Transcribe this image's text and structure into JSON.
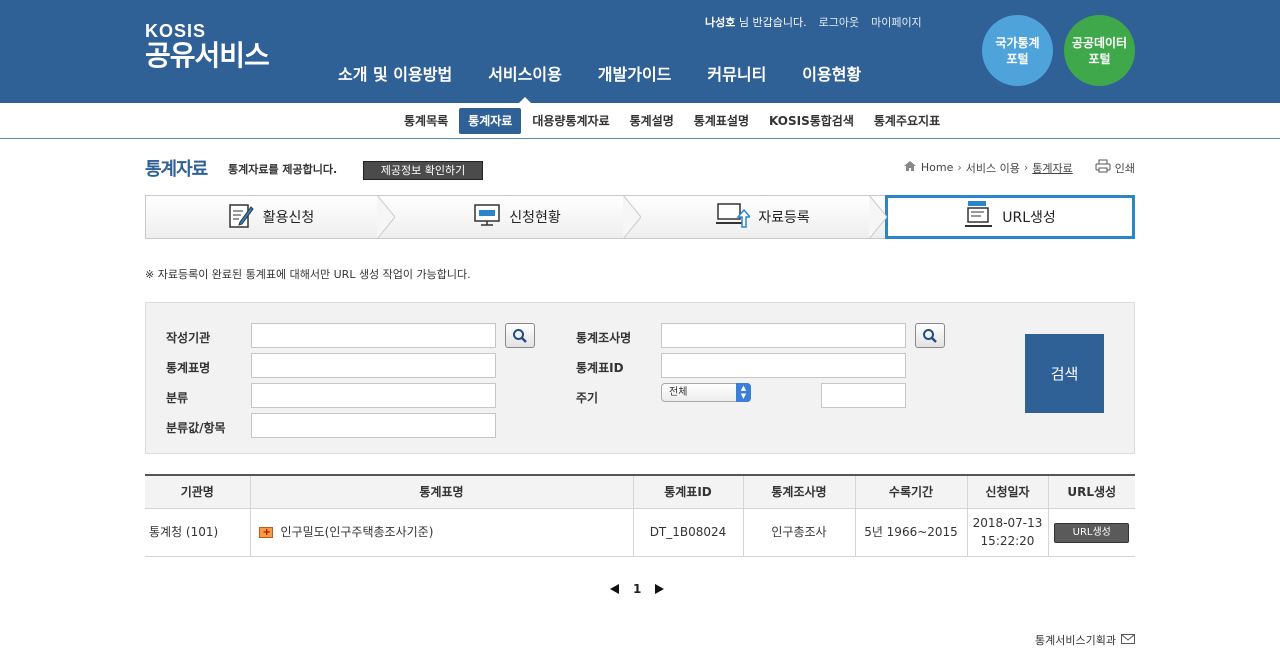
{
  "header": {
    "logo_top": "KOSIS",
    "logo_main": "공유서비스",
    "user_name": "나성호",
    "greeting": "님 반갑습니다.",
    "logout": "로그아웃",
    "mypage": "마이페이지",
    "gnb": [
      "소개 및 이용방법",
      "서비스이용",
      "개발가이드",
      "커뮤니티",
      "이용현황"
    ],
    "gnb_active": "서비스이용",
    "portal1_line1": "국가통계",
    "portal1_line2": "포털",
    "portal2_line1": "공공데이터",
    "portal2_line2": "포털"
  },
  "subnav": [
    "통계목록",
    "통계자료",
    "대용량통계자료",
    "통계설명",
    "통계표설명",
    "KOSIS통합검색",
    "통계주요지표"
  ],
  "page": {
    "title": "통계자료",
    "desc": "통계자료를 제공합니다.",
    "info_button": "제공정보 확인하기",
    "breadcrumb": [
      "Home",
      "서비스 이용",
      "통계자료"
    ],
    "print": "인쇄"
  },
  "steps": [
    "활용신청",
    "신청현황",
    "자료등록",
    "URL생성"
  ],
  "notice": "※ 자료등록이 완료된 통계표에 대해서만 URL 생성 작업이 가능합니다.",
  "search": {
    "org_label": "작성기관",
    "table_name_label": "통계표명",
    "category_label": "분류",
    "category_value_label": "분류값/항목",
    "survey_label": "통계조사명",
    "table_id_label": "통계표ID",
    "cycle_label": "주기",
    "cycle_selected": "전체",
    "search_button": "검색"
  },
  "table": {
    "headers": [
      "기관명",
      "통계표명",
      "통계표ID",
      "통계조사명",
      "수록기간",
      "신청일자",
      "URL생성"
    ],
    "rows": [
      {
        "org": "통계청 (101)",
        "name": "인구밀도(인구주택총조사기준)",
        "id": "DT_1B08024",
        "survey": "인구총조사",
        "period": "5년 1966~2015",
        "date": "2018-07-13",
        "time": "15:22:20",
        "action": "URL생성"
      }
    ]
  },
  "pager": {
    "current": "1"
  },
  "footer": {
    "dept": "통계서비스기획과"
  },
  "colors": {
    "brand": "#2f6096",
    "step_active_border": "#2a86c6",
    "portal1": "#4ea3da",
    "portal2": "#3fa84a"
  }
}
